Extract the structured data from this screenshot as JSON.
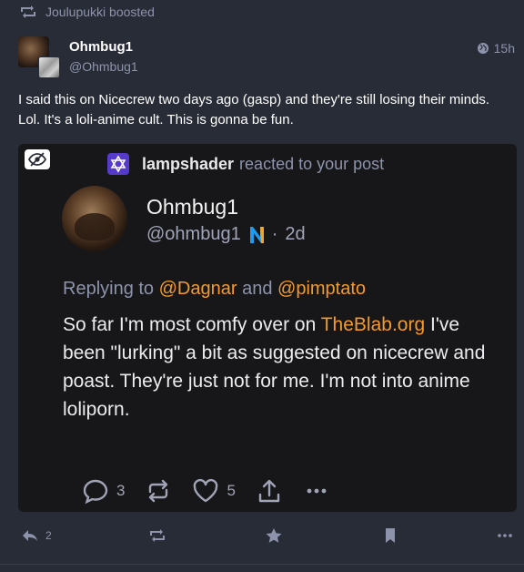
{
  "boost": {
    "text": "Joulupukki boosted",
    "icon": "retweet-icon"
  },
  "author": {
    "display_name": "Ohmbug1",
    "handle": "@Ohmbug1",
    "timestamp": "15h",
    "visibility_icon": "globe-icon"
  },
  "status": {
    "text": "I said this on Nicecrew two days ago (gasp) and they're still losing their minds. Lol. It's a loli-anime cult. This is gonna be fun."
  },
  "embed": {
    "hide_icon": "eye-slash-icon",
    "notification": {
      "icon": "star-of-david-icon",
      "user": "lampshader",
      "action": "reacted to your post"
    },
    "post": {
      "display_name": "Ohmbug1",
      "handle": "@ohmbug1",
      "badge_icon": "n-logo-icon",
      "separator": "·",
      "time": "2d",
      "reply_prefix": "Replying to",
      "reply_to_1": "@Dagnar",
      "reply_and": "and",
      "reply_to_2": "@pimptato",
      "text_before_link": "So far I'm most comfy over on",
      "link_text": "TheBlab.org",
      "text_after_link": "I've been \"lurking\" a bit as suggested on nicecrew and poast. They're just not for me. I'm not into anime loliporn.",
      "replies_count": "3",
      "likes_count": "5"
    }
  },
  "actions": {
    "reply_count": "2",
    "reply_icon": "reply-all-icon",
    "boost_icon": "retweet-icon",
    "favourite_icon": "star-icon",
    "bookmark_icon": "bookmark-icon",
    "more_icon": "ellipsis-icon"
  },
  "colors": {
    "background": "#282c37",
    "embed_background": "#17171a",
    "muted": "#8d93ab",
    "accent_orange": "#f39a2b",
    "notification_purple": "#563acc"
  }
}
